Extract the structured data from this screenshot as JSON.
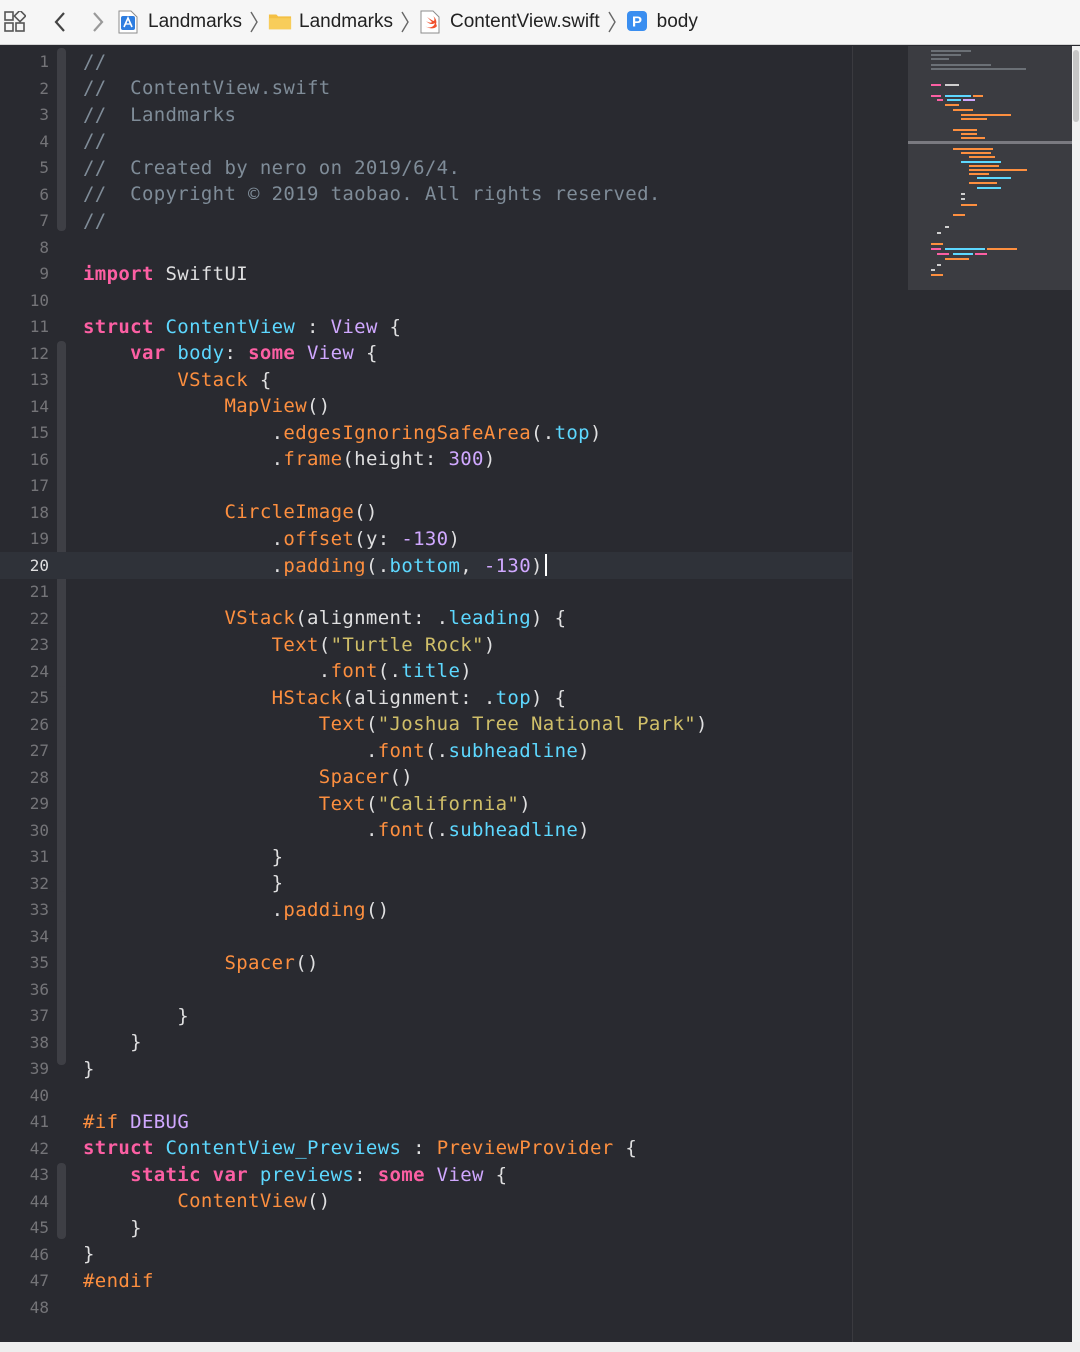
{
  "jumpbar": {
    "crumbs": [
      {
        "label": "Landmarks",
        "icon": "project-icon"
      },
      {
        "label": "Landmarks",
        "icon": "folder-icon"
      },
      {
        "label": "ContentView.swift",
        "icon": "swift-file-icon"
      },
      {
        "label": "body",
        "icon": "property-icon",
        "badge": "P"
      }
    ]
  },
  "editor": {
    "current_line": 20,
    "line_numbers": [
      "1",
      "2",
      "3",
      "4",
      "5",
      "6",
      "7",
      "8",
      "9",
      "10",
      "11",
      "12",
      "13",
      "14",
      "15",
      "16",
      "17",
      "18",
      "19",
      "20",
      "21",
      "22",
      "23",
      "24",
      "25",
      "26",
      "27",
      "28",
      "29",
      "30",
      "31",
      "32",
      "33",
      "34",
      "35",
      "36",
      "37",
      "38",
      "39",
      "40",
      "41",
      "42",
      "43",
      "44",
      "45",
      "46",
      "47",
      "48"
    ]
  },
  "code": {
    "l1": "//",
    "l2": "//  ContentView.swift",
    "l3": "//  Landmarks",
    "l4": "//",
    "l5": "//  Created by nero on 2019/6/4.",
    "l6": "//  Copyright © 2019 taobao. All rights reserved.",
    "l7": "//",
    "l9_kw": "import",
    "l9_mod": " SwiftUI",
    "l11_kw": "struct",
    "l11_name": " ContentView",
    "l11_colon": " : ",
    "l11_type": "View",
    "l11_brace": " {",
    "l12_ind": "    ",
    "l12_kw": "var",
    "l12_name": " body",
    "l12_colon": ": ",
    "l12_kw2": "some",
    "l12_type": " View",
    "l12_brace": " {",
    "l13_ind": "        ",
    "l13_type": "VStack",
    "l13_brace": " {",
    "l14_ind": "            ",
    "l14_type": "MapView",
    "l14_paren": "()",
    "l15_ind": "                ",
    "l15_dot": ".",
    "l15_fn": "edgesIgnoringSafeArea",
    "l15_open": "(.",
    "l15_arg": "top",
    "l15_close": ")",
    "l16_ind": "                ",
    "l16_dot": ".",
    "l16_fn": "frame",
    "l16_open": "(height: ",
    "l16_num": "300",
    "l16_close": ")",
    "l18_ind": "            ",
    "l18_type": "CircleImage",
    "l18_paren": "()",
    "l19_ind": "                ",
    "l19_dot": ".",
    "l19_fn": "offset",
    "l19_open": "(y: ",
    "l19_num": "-130",
    "l19_close": ")",
    "l20_ind": "                ",
    "l20_dot": ".",
    "l20_fn": "padding",
    "l20_open": "(.",
    "l20_arg": "bottom",
    "l20_comma": ", ",
    "l20_num": "-130",
    "l20_close": ")",
    "l22_ind": "            ",
    "l22_type": "VStack",
    "l22_open": "(alignment: .",
    "l22_arg": "leading",
    "l22_close": ") {",
    "l23_ind": "                ",
    "l23_type": "Text",
    "l23_open": "(",
    "l23_str": "\"Turtle Rock\"",
    "l23_close": ")",
    "l24_ind": "                    ",
    "l24_dot": ".",
    "l24_fn": "font",
    "l24_open": "(.",
    "l24_arg": "title",
    "l24_close": ")",
    "l25_ind": "                ",
    "l25_type": "HStack",
    "l25_open": "(alignment: .",
    "l25_arg": "top",
    "l25_close": ") {",
    "l26_ind": "                    ",
    "l26_type": "Text",
    "l26_open": "(",
    "l26_str": "\"Joshua Tree National Park\"",
    "l26_close": ")",
    "l27_ind": "                        ",
    "l27_dot": ".",
    "l27_fn": "font",
    "l27_open": "(.",
    "l27_arg": "subheadline",
    "l27_close": ")",
    "l28_ind": "                    ",
    "l28_type": "Spacer",
    "l28_paren": "()",
    "l29_ind": "                    ",
    "l29_type": "Text",
    "l29_open": "(",
    "l29_str": "\"California\"",
    "l29_close": ")",
    "l30_ind": "                        ",
    "l30_dot": ".",
    "l30_fn": "font",
    "l30_open": "(.",
    "l30_arg": "subheadline",
    "l30_close": ")",
    "l31": "                }",
    "l32": "                }",
    "l33_ind": "                ",
    "l33_dot": ".",
    "l33_fn": "padding",
    "l33_paren": "()",
    "l35_ind": "            ",
    "l35_type": "Spacer",
    "l35_paren": "()",
    "l37": "        }",
    "l38": "    }",
    "l39": "}",
    "l41_pp": "#if",
    "l41_arg": " DEBUG",
    "l42_kw": "struct",
    "l42_name": " ContentView_Previews",
    "l42_colon": " : ",
    "l42_type": "PreviewProvider",
    "l42_brace": " {",
    "l43_ind": "    ",
    "l43_kw": "static",
    "l43_kw2": " var",
    "l43_name": " previews",
    "l43_colon": ": ",
    "l43_kw3": "some",
    "l43_type": " View",
    "l43_brace": " {",
    "l44_ind": "        ",
    "l44_type": "ContentView",
    "l44_paren": "()",
    "l45": "    }",
    "l46": "}",
    "l47_pp": "#endif"
  },
  "colors": {
    "editor_background": "#292a30",
    "keyword": "#fc5fa3",
    "comment": "#7f8c98",
    "type": "#d0a8ff",
    "call": "#fd8f3f",
    "number": "#d0bf69",
    "string": "#fc6a5d",
    "member": "#5dd8ff"
  }
}
